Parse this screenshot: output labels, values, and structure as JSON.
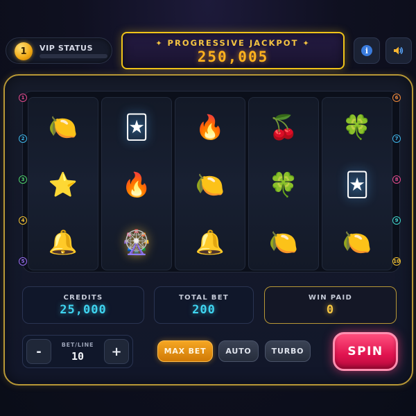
{
  "vip": {
    "level": "1",
    "label": "VIP STATUS",
    "progress": 0
  },
  "jackpot": {
    "title": "PROGRESSIVE JACKPOT",
    "sparkle": "✦",
    "value": "250,005"
  },
  "buttons": {
    "info_icon": "info-icon",
    "sound_icon": "speaker-icon"
  },
  "reels": [
    {
      "symbols": [
        {
          "glyph": "🍋",
          "name": "lemon"
        },
        {
          "glyph": "🃏",
          "name": "joker",
          "glow": "blue"
        },
        {
          "glyph": "🔥",
          "name": "fire"
        }
      ]
    },
    {
      "symbols": [
        {
          "glyph": "🔥",
          "name": "fire"
        },
        {
          "glyph": "🍒",
          "name": "cherry"
        },
        {
          "glyph": "🍀",
          "name": "clover"
        }
      ]
    }
  ],
  "grid": [
    [
      {
        "glyph": "🍋",
        "name": "lemon"
      },
      {
        "glyph": "🃏",
        "name": "joker",
        "glow": "blue"
      },
      {
        "glyph": "🔥",
        "name": "fire"
      },
      {
        "glyph": "🍒",
        "name": "cherry"
      },
      {
        "glyph": "🍀",
        "name": "clover"
      }
    ],
    [
      {
        "glyph": "⭐",
        "name": "star"
      },
      {
        "glyph": "🔥",
        "name": "fire"
      },
      {
        "glyph": "🍋",
        "name": "lemon"
      },
      {
        "glyph": "🍀",
        "name": "clover"
      },
      {
        "glyph": "🃏",
        "name": "joker",
        "glow": "blue"
      }
    ],
    [
      {
        "glyph": "🔔",
        "name": "bell"
      },
      {
        "glyph": "🎡",
        "name": "wheel",
        "glow": "gold"
      },
      {
        "glyph": "🔔",
        "name": "bell"
      },
      {
        "glyph": "🍋",
        "name": "lemon"
      },
      {
        "glyph": "🍋",
        "name": "lemon"
      }
    ]
  ],
  "paylines_left": [
    {
      "num": "1",
      "color": "#e04a8a"
    },
    {
      "num": "2",
      "color": "#3fb6e8"
    },
    {
      "num": "3",
      "color": "#4ed06a"
    },
    {
      "num": "4",
      "color": "#f2c232"
    },
    {
      "num": "5",
      "color": "#9a6cf0"
    }
  ],
  "paylines_right": [
    {
      "num": "6",
      "color": "#f08a3a"
    },
    {
      "num": "7",
      "color": "#3fb6e8"
    },
    {
      "num": "8",
      "color": "#e04a8a"
    },
    {
      "num": "9",
      "color": "#3fd4c8"
    },
    {
      "num": "10",
      "color": "#f2c232"
    }
  ],
  "stats": {
    "credits_label": "CREDITS",
    "credits_value": "25,000",
    "total_bet_label": "TOTAL BET",
    "total_bet_value": "200",
    "win_label": "WIN PAID",
    "win_value": "0"
  },
  "controls": {
    "betline_label": "BET/LINE",
    "betline_value": "10",
    "minus": "-",
    "plus": "+",
    "max_bet": "MAX BET",
    "auto": "AUTO",
    "turbo": "TURBO",
    "spin": "SPIN"
  },
  "colors": {
    "gold": "#f0c419",
    "spin": "#e0134f",
    "accent_cyan": "#3fd4f0"
  }
}
